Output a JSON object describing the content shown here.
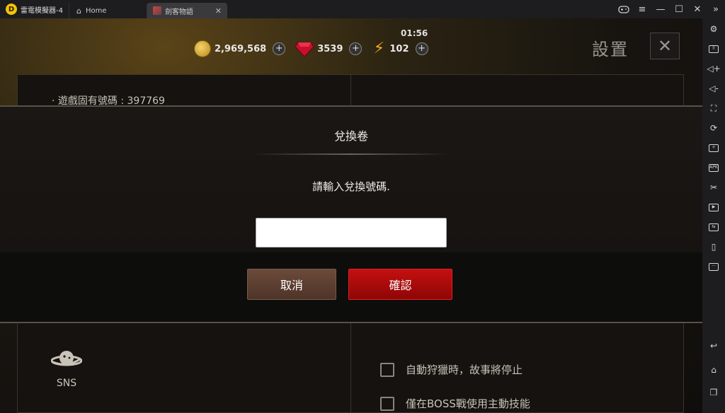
{
  "titlebar": {
    "app_name": "雷電模擬器-4",
    "tabs": [
      {
        "label": "Home"
      },
      {
        "label": "劍客物語"
      }
    ],
    "window_controls": [
      "gamepad-icon",
      "menu-icon",
      "minimize-icon",
      "maximize-icon",
      "close-icon"
    ]
  },
  "hud": {
    "time": "01:56",
    "gold": "2,969,568",
    "gems": "3539",
    "energy": "102",
    "plus_label": "+"
  },
  "settings": {
    "title": "設置",
    "close_glyph": "✕",
    "game_id": "· 遊戲固有號碼 : 397769",
    "sns_label": "SNS",
    "options": [
      {
        "label": "自動狩獵時，故事將停止"
      },
      {
        "label": "僅在BOSS戰使用主動技能"
      }
    ]
  },
  "modal": {
    "title": "兌換卷",
    "message": "請輸入兌換號碼.",
    "input_value": "",
    "cancel_label": "取消",
    "confirm_label": "確認"
  },
  "colors": {
    "confirm_red": "#b00a0a",
    "cancel_brown": "#5c3f31",
    "gold": "#d6a93a"
  }
}
